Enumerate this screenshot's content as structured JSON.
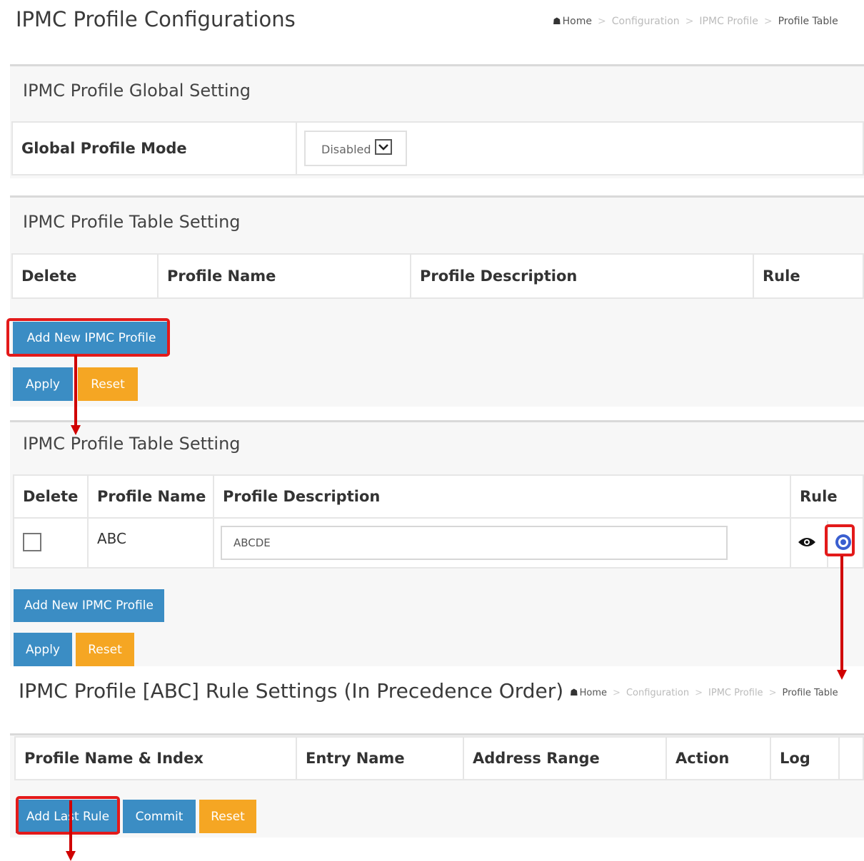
{
  "header1": {
    "title": "IPMC Profile Configurations",
    "breadcrumb": {
      "home": "Home",
      "items": [
        "Configuration",
        "IPMC Profile"
      ],
      "current": "Profile Table"
    }
  },
  "global": {
    "title": "IPMC Profile Global Setting",
    "label": "Global Profile Mode",
    "select_value": "Disabled"
  },
  "table1": {
    "title": "IPMC Profile Table Setting",
    "headers": [
      "Delete",
      "Profile Name",
      "Profile Description",
      "Rule"
    ]
  },
  "buttons1": {
    "add": "Add New IPMC Profile",
    "apply": "Apply",
    "reset": "Reset"
  },
  "table2": {
    "title": "IPMC Profile Table Setting",
    "headers": [
      "Delete",
      "Profile Name",
      "Profile Description",
      "Rule"
    ],
    "row": {
      "name": "ABC",
      "description": "ABCDE"
    }
  },
  "buttons2": {
    "add": "Add New IPMC Profile",
    "apply": "Apply",
    "reset": "Reset"
  },
  "header2": {
    "title": "IPMC Profile [ABC] Rule Settings (In Precedence Order)",
    "breadcrumb": {
      "home": "Home",
      "items": [
        "Configuration",
        "IPMC Profile"
      ],
      "current": "Profile Table"
    }
  },
  "rule_table": {
    "headers": [
      "Profile Name & Index",
      "Entry Name",
      "Address Range",
      "Action",
      "Log"
    ]
  },
  "buttons3": {
    "add_last": "Add Last Rule",
    "commit": "Commit",
    "reset": "Reset"
  },
  "colors": {
    "primary": "#3b8dc4",
    "warning": "#f5a623",
    "annotation": "#e31a1a"
  },
  "icons": [
    "home-icon",
    "view-eye-icon",
    "edit-rule-icon",
    "chevron-down-icon"
  ]
}
